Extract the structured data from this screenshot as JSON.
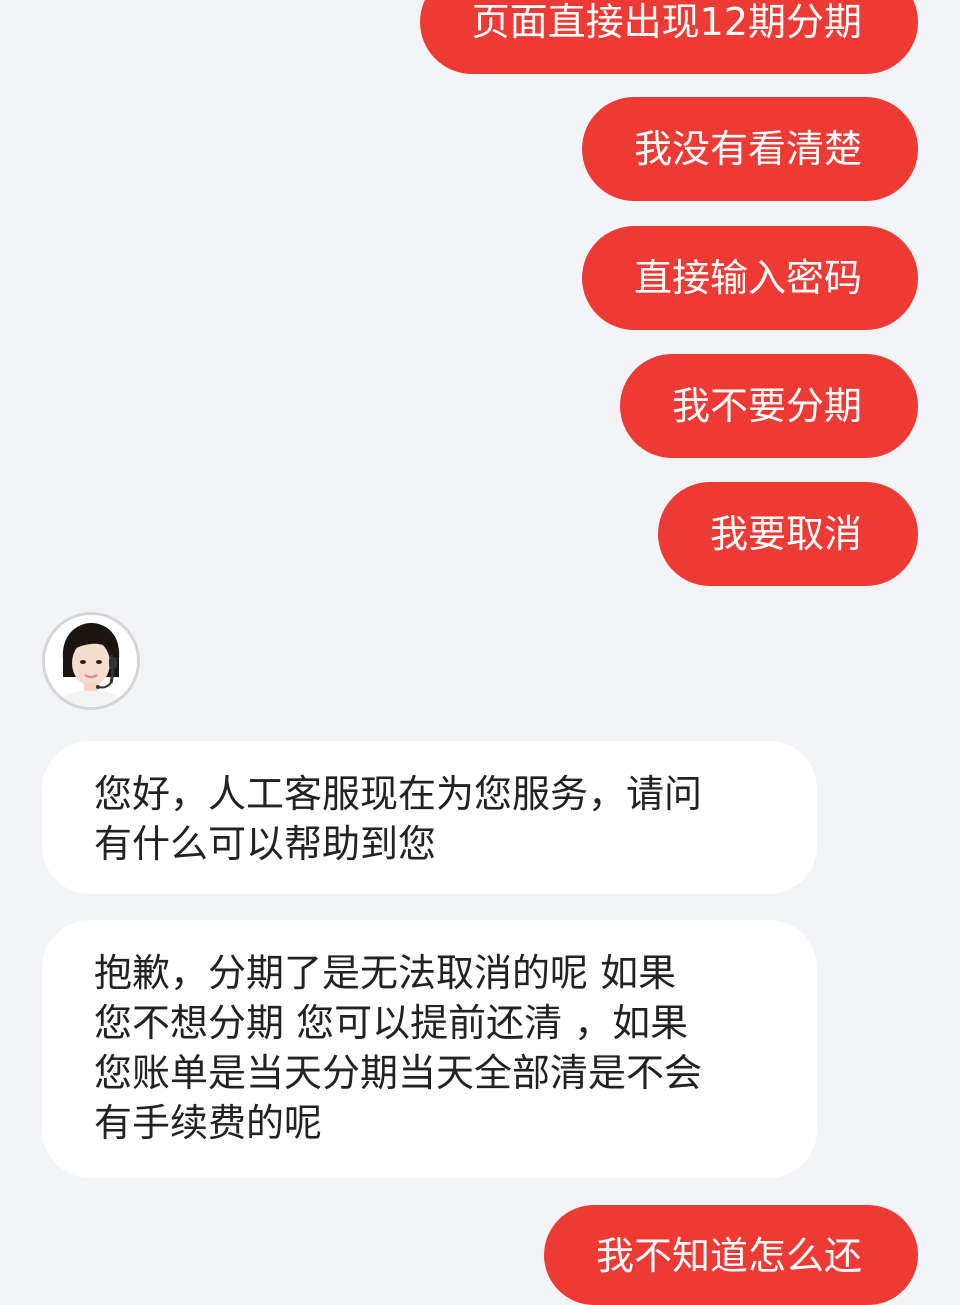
{
  "chat": {
    "sent_top": [
      "页面直接出现12期分期",
      "我没有看清楚",
      "直接输入密码",
      "我不要分期",
      "我要取消"
    ],
    "agent": {
      "avatar": "customer-service-agent-avatar",
      "messages": [
        [
          "您好，人工客服现在为您服务，请问",
          "有什么可以帮助到您"
        ],
        [
          "抱歉，分期了是无法取消的呢 如果",
          "您不想分期 您可以提前还清 ，如果",
          "您账单是当天分期当天全部清是不会",
          "有手续费的呢"
        ]
      ]
    },
    "sent_bottom": [
      "我不知道怎么还"
    ],
    "colors": {
      "background": "#f3f4f7",
      "sent_bubble": "#ee3a34",
      "received_bubble": "#ffffff"
    }
  }
}
